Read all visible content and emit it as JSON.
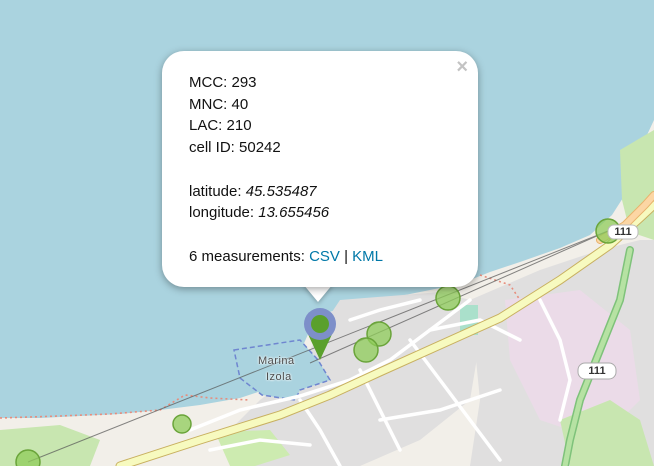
{
  "popup": {
    "close_label": "×",
    "mcc_label": "MCC:",
    "mcc_value": "293",
    "mnc_label": "MNC:",
    "mnc_value": "40",
    "lac_label": "LAC:",
    "lac_value": "210",
    "cellid_label": "cell ID:",
    "cellid_value": "50242",
    "latitude_label": "latitude:",
    "latitude_value": "45.535487",
    "longitude_label": "longitude:",
    "longitude_value": "13.655456",
    "measurements_label": "6 measurements:",
    "csv_link": "CSV",
    "separator": "|",
    "kml_link": "KML"
  },
  "map_labels": {
    "marina_line1": "Marina",
    "marina_line2": "Izola",
    "road_111_a": "111",
    "road_111_b": "111"
  },
  "colors": {
    "water": "#aad3df",
    "land": "#f2efe9",
    "measurement_fill": "#8fcc5a",
    "marker_blue": "#6a8ec8",
    "marker_green": "#5aa02c",
    "link": "#0078a8"
  },
  "icons": [
    "close-icon",
    "map-marker-icon"
  ]
}
